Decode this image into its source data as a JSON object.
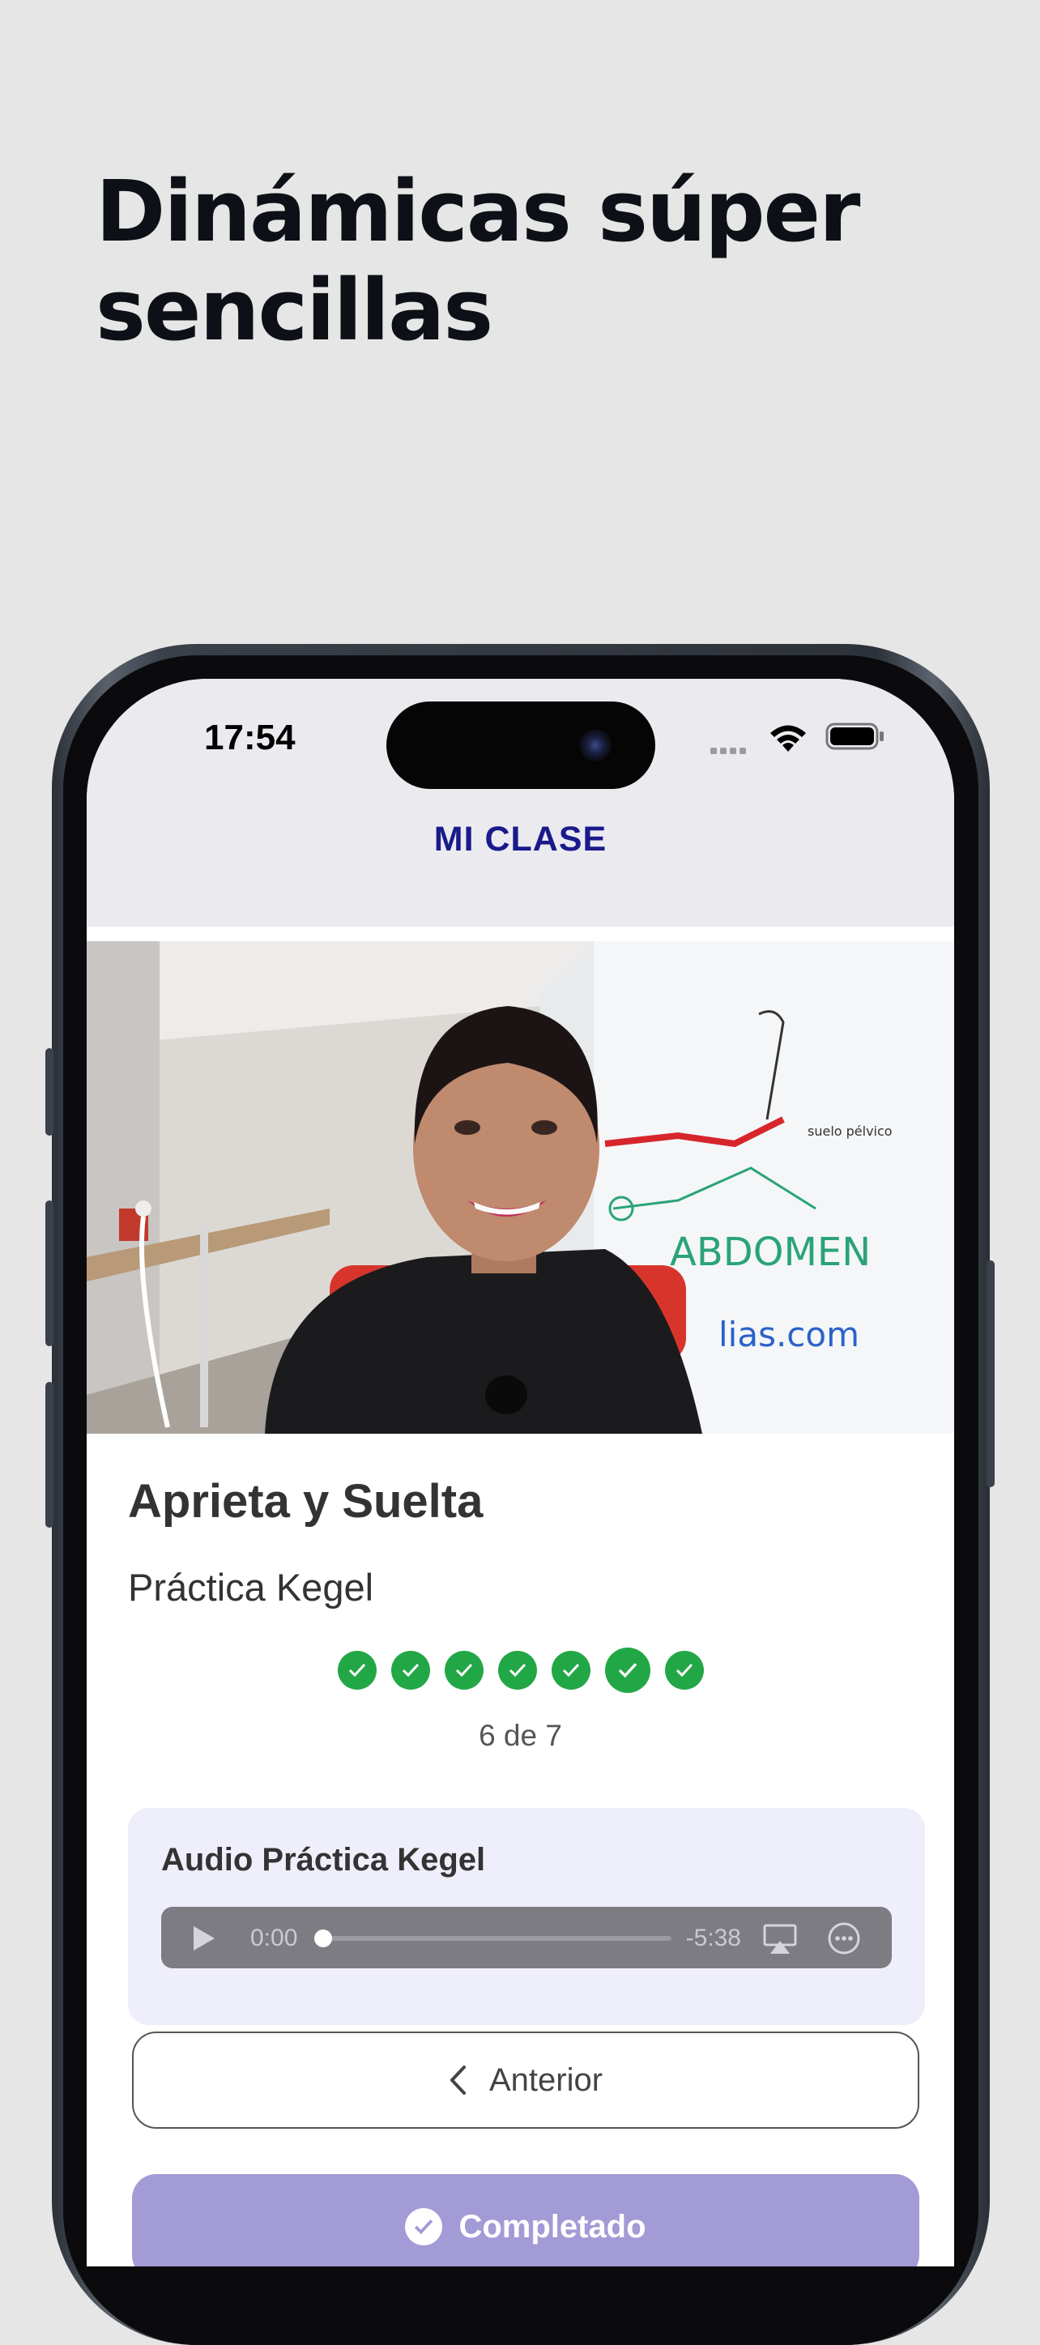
{
  "headline": {
    "line1": "Dinámicas súper",
    "line2": "sencillas"
  },
  "status_bar": {
    "time": "17:54"
  },
  "nav": {
    "title": "MI CLASE"
  },
  "video": {
    "whiteboard_text_1": "ABDOMEN",
    "whiteboard_text_2": "suelo pélvico",
    "whiteboard_text_3": "lias.com"
  },
  "lesson": {
    "title": "Aprieta y Suelta",
    "subtitle": "Práctica Kegel",
    "progress_text": "6 de 7",
    "steps_total": 7,
    "steps_completed": 7,
    "current_step": 6
  },
  "audio": {
    "title": "Audio Práctica Kegel",
    "current_time": "0:00",
    "remaining_time": "-5:38",
    "progress": 0
  },
  "buttons": {
    "previous_label": "Anterior",
    "completed_label": "Completado"
  },
  "colors": {
    "background": "#e6e6e6",
    "nav_title": "#1a1a8c",
    "step_done": "#22a747",
    "audio_card": "#efeefb",
    "completed_button": "#a29bd6"
  }
}
